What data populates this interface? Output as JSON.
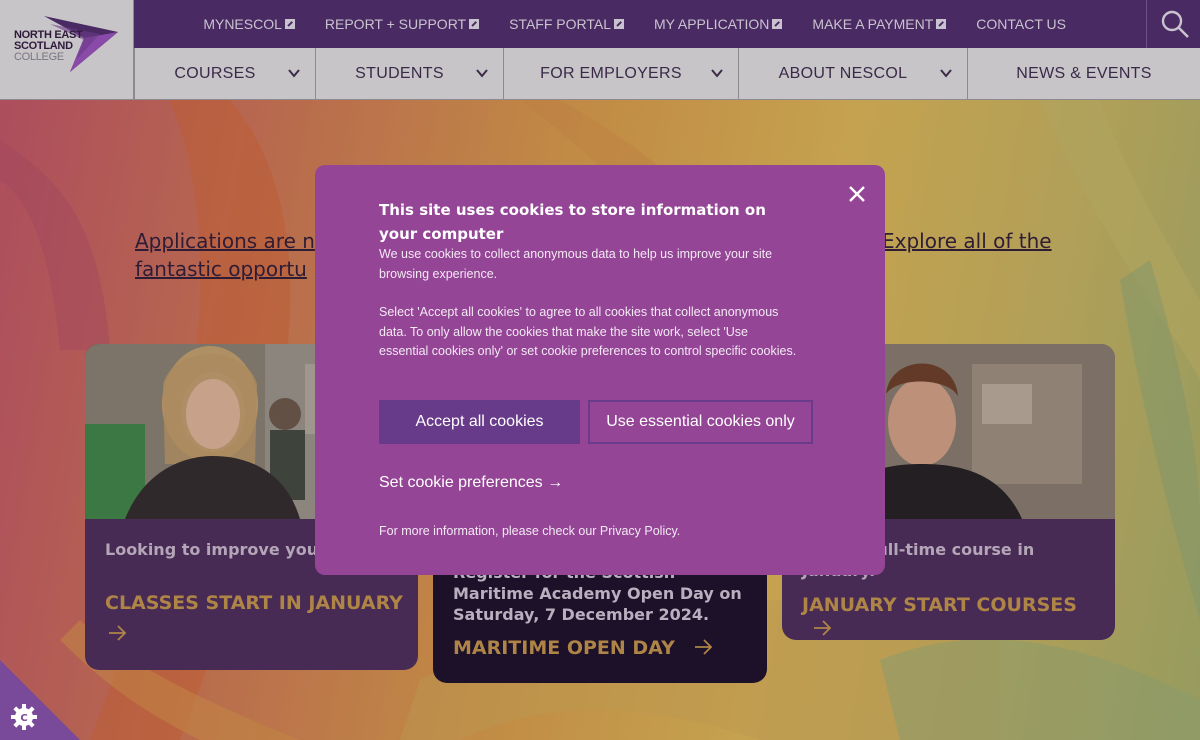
{
  "brand": {
    "logo_lines": [
      "NORTH EAST",
      "SCOTLAND",
      "COLLEGE"
    ],
    "accent": "#4a2a62",
    "modal_color": "#944595"
  },
  "top_links": [
    {
      "label": "MYNESCOL",
      "external": true
    },
    {
      "label": "REPORT + SUPPORT",
      "external": true
    },
    {
      "label": "STAFF PORTAL",
      "external": true
    },
    {
      "label": "MY APPLICATION",
      "external": true
    },
    {
      "label": "MAKE A PAYMENT",
      "external": true
    },
    {
      "label": "CONTACT US",
      "external": false
    }
  ],
  "main_nav": [
    {
      "label": "COURSES"
    },
    {
      "label": "STUDENTS"
    },
    {
      "label": "FOR EMPLOYERS"
    },
    {
      "label": "ABOUT NESCOL"
    },
    {
      "label": "NEWS & EVENTS"
    }
  ],
  "intro": {
    "line1_start": "Applications are n",
    "line1_end": "Explore all of the",
    "line2_start": "fantastic opportu"
  },
  "cards": [
    {
      "desc": "Looking to improve your skills?",
      "cta_line1": "CLASSES START IN JANUARY"
    },
    {
      "desc": "Register for the Scottish Maritime Academy Open Day on Saturday, 7 December 2024.",
      "cta_line1": "MARITIME OPEN DAY"
    },
    {
      "desc": "Start a full-time course in January.",
      "cta_line1": "JANUARY START COURSES"
    }
  ],
  "cookie_modal": {
    "title": "This site uses cookies to store information on your computer",
    "paragraph1": "We use cookies to collect anonymous data to help us improve your site browsing experience.",
    "paragraph2": "Select 'Accept all cookies' to agree to all cookies that collect anonymous data. To only allow the cookies that make the site work, select 'Use essential cookies only' or set cookie preferences to control specific cookies.",
    "accept_label": "Accept all cookies",
    "essential_label": "Use essential cookies only",
    "preferences_label": "Set cookie preferences →",
    "more_info": "For more information, please check our Privacy Policy."
  }
}
